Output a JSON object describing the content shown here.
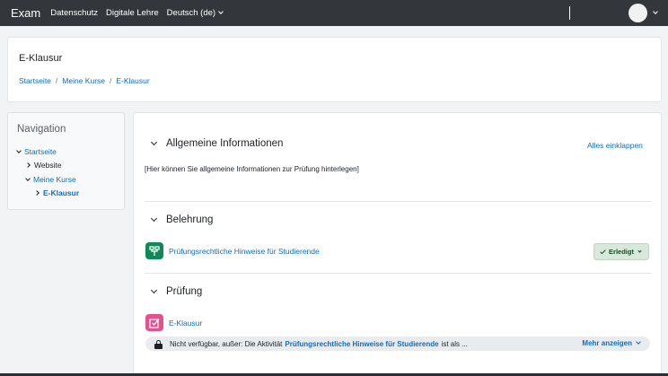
{
  "navbar": {
    "brand": "Exam",
    "links": [
      "Datenschutz",
      "Digitale Lehre"
    ],
    "language": "Deutsch (de)"
  },
  "header": {
    "title": "E-Klausur",
    "breadcrumb": [
      "Startseite",
      "Meine Kurse",
      "E-Klausur"
    ]
  },
  "navigation": {
    "title": "Navigation",
    "items": [
      {
        "label": "Startseite"
      },
      {
        "label": "Website"
      },
      {
        "label": "Meine Kurse"
      },
      {
        "label": "E-Klausur"
      }
    ]
  },
  "course": {
    "collapse_all": "Alles einklappen",
    "sections": [
      {
        "title": "Allgemeine Informationen",
        "summary": "[Hier können Sie allgemeine Informationen zur Prüfung hinterlegen]"
      },
      {
        "title": "Belehrung",
        "activity": {
          "name": "Prüfungsrechtliche Hinweise für Studierende",
          "icon": "folder-tree-icon",
          "icon_color": "#0d8a55",
          "completion": "Erledigt"
        }
      },
      {
        "title": "Prüfung",
        "activity": {
          "name": "E-Klausur",
          "icon": "quiz-icon",
          "icon_color": "#e5508f",
          "restriction": {
            "prefix": "Nicht verfügbar, außer: Die Aktivität",
            "activity": "Prüfungsrechtliche Hinweise für Studierende",
            "suffix": "ist als ...",
            "more": "Mehr anzeigen"
          }
        }
      }
    ]
  },
  "colors": {
    "navbar": "#33373c",
    "link": "#0f6cbf",
    "done_badge": "#d7e9da"
  }
}
